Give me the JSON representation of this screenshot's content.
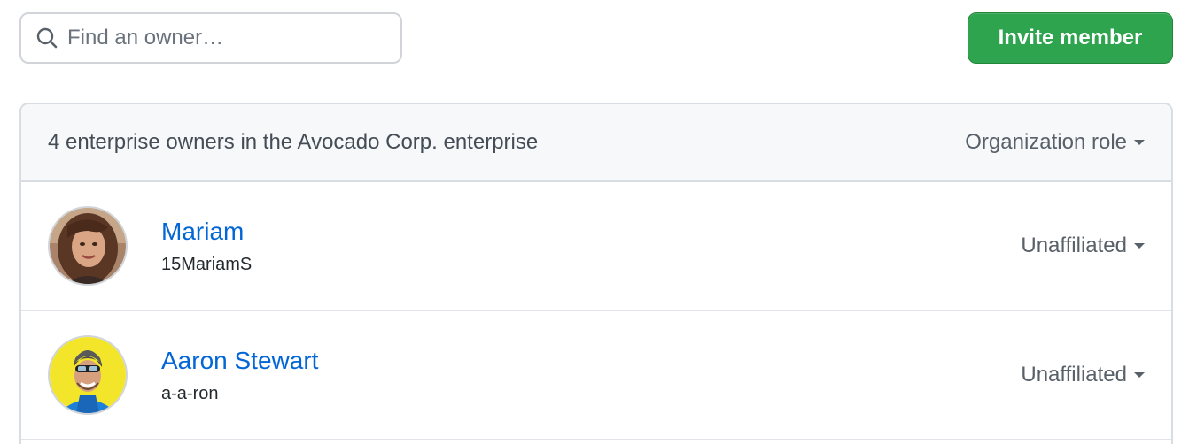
{
  "search": {
    "placeholder": "Find an owner…",
    "value": "",
    "icon": "search-icon"
  },
  "invite_button": {
    "label": "Invite member",
    "color": "#2ea44f"
  },
  "panel": {
    "header_text": "4 enterprise owners in the Avocado Corp. enterprise",
    "role_filter_label": "Organization role"
  },
  "members": [
    {
      "name": "Mariam",
      "login": "15MariamS",
      "role": "Unaffiliated",
      "avatar": "avatar-photo-mariam"
    },
    {
      "name": "Aaron Stewart",
      "login": "a-a-ron",
      "role": "Unaffiliated",
      "avatar": "avatar-photo-aaron"
    }
  ],
  "colors": {
    "link": "#0366d6",
    "header_bg": "#f6f8fa",
    "border": "#d8dde3"
  }
}
